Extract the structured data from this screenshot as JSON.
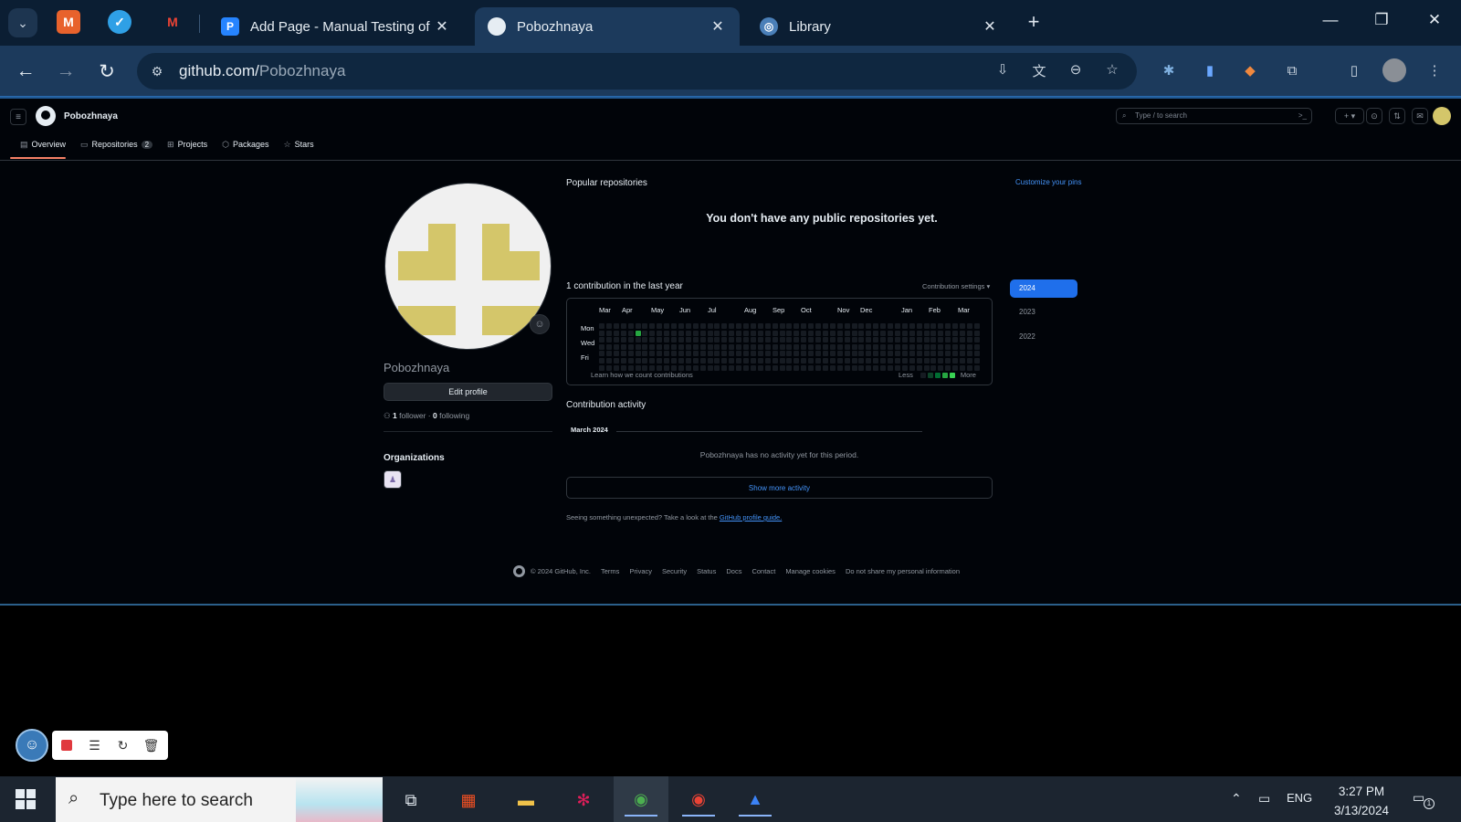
{
  "browser": {
    "tabs": [
      {
        "title": "Add Page - Manual Testing of C",
        "favicon": "P"
      },
      {
        "title": "Pobozhnaya"
      },
      {
        "title": "Library"
      }
    ],
    "url_host": "github.com/",
    "url_path": "Pobozhnaya"
  },
  "github": {
    "header_user": "Pobozhnaya",
    "search_placeholder": "Type / to search",
    "nav": {
      "overview": "Overview",
      "repositories": "Repositories",
      "repositories_count": "2",
      "projects": "Projects",
      "packages": "Packages",
      "stars": "Stars"
    },
    "profile": {
      "nickname": "Pobozhnaya",
      "edit_label": "Edit profile",
      "followers": "1",
      "followers_label": "follower",
      "following": "0",
      "following_label": "following",
      "organizations_title": "Organizations"
    },
    "popular_title": "Popular repositories",
    "customize_label": "Customize your pins",
    "no_repos": "You don't have any public repositories yet.",
    "contrib_title": "1 contribution in the last year",
    "contrib_settings": "Contribution settings ▾",
    "months": [
      "Mar",
      "Apr",
      "May",
      "Jun",
      "Jul",
      "Aug",
      "Sep",
      "Oct",
      "Nov",
      "Dec",
      "Jan",
      "Feb",
      "Mar"
    ],
    "days": [
      "Mon",
      "Wed",
      "Fri"
    ],
    "learn": "Learn how we count contributions",
    "legend_less": "Less",
    "legend_more": "More",
    "contribution_cell": {
      "week": 5,
      "day": 1,
      "level_color": "#26a641"
    },
    "years": [
      "2024",
      "2023",
      "2022"
    ],
    "activity_title": "Contribution activity",
    "activity_month": "March 2024",
    "no_activity": "Pobozhnaya has no activity yet for this period.",
    "show_more": "Show more activity",
    "unexpected": "Seeing something unexpected? Take a look at the",
    "guide_link": "GitHub profile guide.",
    "footer": [
      "© 2024 GitHub, Inc.",
      "Terms",
      "Privacy",
      "Security",
      "Status",
      "Docs",
      "Contact",
      "Manage cookies",
      "Do not share my personal information"
    ]
  },
  "taskbar": {
    "search_placeholder": "Type here to search",
    "lang": "ENG",
    "time": "3:27 PM",
    "date": "3/13/2024",
    "notifications": "1"
  },
  "colors": {
    "accent": "#1f6feb",
    "link": "#4493f8",
    "page_bg": "#010409",
    "avatar_yellow": "#d4c66a"
  }
}
